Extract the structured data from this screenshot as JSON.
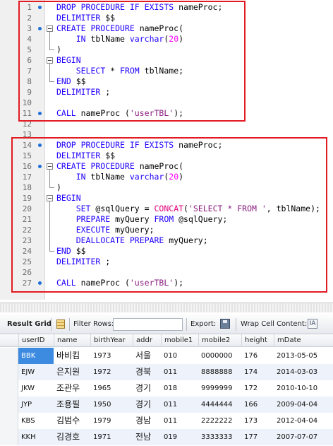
{
  "editor": {
    "lines": [
      {
        "n": "1",
        "marker": true,
        "tokens": [
          [
            "kw",
            "DROP PROCEDURE IF EXISTS"
          ],
          [
            "",
            " nameProc;"
          ]
        ]
      },
      {
        "n": "2",
        "marker": false,
        "tokens": [
          [
            "kw",
            "DELIMITER"
          ],
          [
            "",
            " $$"
          ]
        ]
      },
      {
        "n": "3",
        "marker": true,
        "tokens": [
          [
            "kw",
            "CREATE PROCEDURE"
          ],
          [
            "",
            " nameProc("
          ]
        ]
      },
      {
        "n": "4",
        "marker": false,
        "tokens": [
          [
            "",
            "    "
          ],
          [
            "kw",
            "IN"
          ],
          [
            "",
            " tblName "
          ],
          [
            "kw",
            "varchar"
          ],
          [
            "",
            "("
          ],
          [
            "num",
            "20"
          ],
          [
            "",
            ")"
          ]
        ]
      },
      {
        "n": "5",
        "marker": false,
        "tokens": [
          [
            "",
            ")"
          ]
        ]
      },
      {
        "n": "6",
        "marker": false,
        "tokens": [
          [
            "kw",
            "BEGIN"
          ]
        ]
      },
      {
        "n": "7",
        "marker": false,
        "tokens": [
          [
            "",
            "    "
          ],
          [
            "kw",
            "SELECT"
          ],
          [
            "",
            " * "
          ],
          [
            "kw",
            "FROM"
          ],
          [
            "",
            " tblName;"
          ]
        ]
      },
      {
        "n": "8",
        "marker": false,
        "tokens": [
          [
            "kw",
            "END"
          ],
          [
            "",
            " $$"
          ]
        ]
      },
      {
        "n": "9",
        "marker": false,
        "tokens": [
          [
            "kw",
            "DELIMITER"
          ],
          [
            "",
            " ;"
          ]
        ]
      },
      {
        "n": "10",
        "marker": false,
        "tokens": []
      },
      {
        "n": "11",
        "marker": true,
        "tokens": [
          [
            "kw",
            "CALL"
          ],
          [
            "",
            " nameProc ("
          ],
          [
            "str",
            "'userTBL'"
          ],
          [
            "",
            ");"
          ]
        ]
      },
      {
        "n": "12",
        "marker": false,
        "tokens": []
      },
      {
        "n": "13",
        "marker": false,
        "tokens": []
      },
      {
        "n": "14",
        "marker": true,
        "tokens": [
          [
            "kw",
            "DROP PROCEDURE IF EXISTS"
          ],
          [
            "",
            " nameProc;"
          ]
        ]
      },
      {
        "n": "15",
        "marker": false,
        "tokens": [
          [
            "kw",
            "DELIMITER"
          ],
          [
            "",
            " $$"
          ]
        ]
      },
      {
        "n": "16",
        "marker": true,
        "tokens": [
          [
            "kw",
            "CREATE PROCEDURE"
          ],
          [
            "",
            " nameProc("
          ]
        ]
      },
      {
        "n": "17",
        "marker": false,
        "tokens": [
          [
            "",
            "    "
          ],
          [
            "kw",
            "IN"
          ],
          [
            "",
            " tblName "
          ],
          [
            "kw",
            "varchar"
          ],
          [
            "",
            "("
          ],
          [
            "num",
            "20"
          ],
          [
            "",
            ")"
          ]
        ]
      },
      {
        "n": "18",
        "marker": false,
        "tokens": [
          [
            "",
            ")"
          ]
        ]
      },
      {
        "n": "19",
        "marker": false,
        "tokens": [
          [
            "kw",
            "BEGIN"
          ]
        ]
      },
      {
        "n": "20",
        "marker": false,
        "tokens": [
          [
            "",
            "    "
          ],
          [
            "kw",
            "SET"
          ],
          [
            "",
            " @sqlQuery = "
          ],
          [
            "fn",
            "CONCAT"
          ],
          [
            "",
            "("
          ],
          [
            "str",
            "'SELECT * FROM '"
          ],
          [
            "",
            ", tblName);"
          ]
        ]
      },
      {
        "n": "21",
        "marker": false,
        "tokens": [
          [
            "",
            "    "
          ],
          [
            "kw",
            "PREPARE"
          ],
          [
            "",
            " myQuery "
          ],
          [
            "kw",
            "FROM"
          ],
          [
            "",
            " @sqlQuery;"
          ]
        ]
      },
      {
        "n": "22",
        "marker": false,
        "tokens": [
          [
            "",
            "    "
          ],
          [
            "kw",
            "EXECUTE"
          ],
          [
            "",
            " myQuery;"
          ]
        ]
      },
      {
        "n": "23",
        "marker": false,
        "tokens": [
          [
            "",
            "    "
          ],
          [
            "kw",
            "DEALLOCATE PREPARE"
          ],
          [
            "",
            " myQuery;"
          ]
        ]
      },
      {
        "n": "24",
        "marker": false,
        "tokens": [
          [
            "kw",
            "END"
          ],
          [
            "",
            " $$"
          ]
        ]
      },
      {
        "n": "25",
        "marker": false,
        "tokens": [
          [
            "kw",
            "DELIMITER"
          ],
          [
            "",
            " ;"
          ]
        ]
      },
      {
        "n": "26",
        "marker": false,
        "tokens": []
      },
      {
        "n": "27",
        "marker": true,
        "tokens": [
          [
            "kw",
            "CALL"
          ],
          [
            "",
            " nameProc ("
          ],
          [
            "str",
            "'userTBL'"
          ],
          [
            "",
            ");"
          ]
        ]
      }
    ]
  },
  "toolbar": {
    "result_grid": "Result Grid",
    "filter_rows": "Filter Rows:",
    "filter_value": "",
    "export": "Export:",
    "wrap": "Wrap Cell Content:",
    "wrap_icon": "IA"
  },
  "grid": {
    "columns": [
      "userID",
      "name",
      "birthYear",
      "addr",
      "mobile1",
      "mobile2",
      "height",
      "mDate"
    ],
    "rows": [
      [
        "BBK",
        "바비킴",
        "1973",
        "서울",
        "010",
        "0000000",
        "176",
        "2013-05-05"
      ],
      [
        "EJW",
        "은지원",
        "1972",
        "경북",
        "011",
        "8888888",
        "174",
        "2014-03-03"
      ],
      [
        "JKW",
        "조관우",
        "1965",
        "경기",
        "018",
        "9999999",
        "172",
        "2010-10-10"
      ],
      [
        "JYP",
        "조용필",
        "1950",
        "경기",
        "011",
        "4444444",
        "166",
        "2009-04-04"
      ],
      [
        "KBS",
        "김범수",
        "1979",
        "경남",
        "011",
        "2222222",
        "173",
        "2012-04-04"
      ],
      [
        "KKH",
        "김경호",
        "1971",
        "전남",
        "019",
        "3333333",
        "177",
        "2007-07-07"
      ]
    ]
  },
  "colors": {
    "highlight_box": "#e21b23",
    "keyword": "#1f00ff",
    "string": "#8a1b7f",
    "selected_cell": "#3d8be0"
  }
}
